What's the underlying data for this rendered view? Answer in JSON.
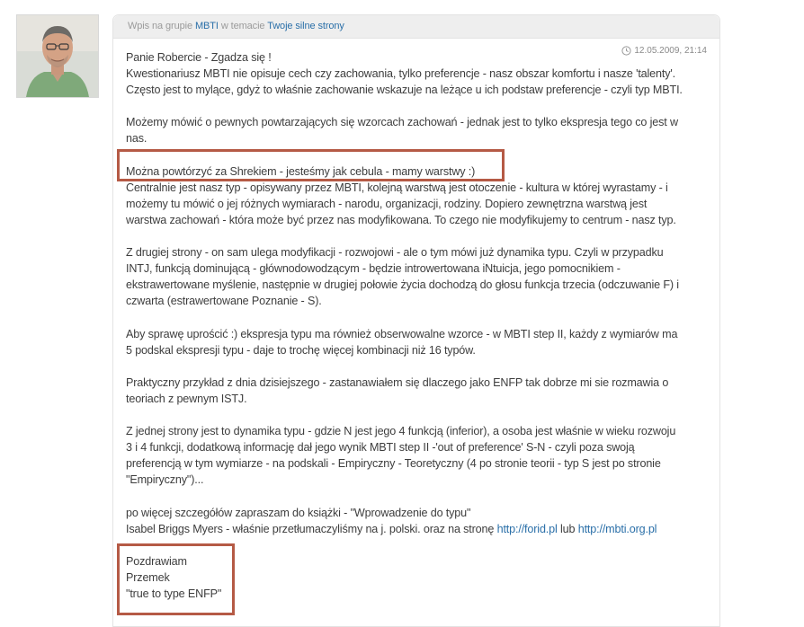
{
  "header": {
    "prefix": "Wpis na grupie",
    "group_link": "MBTI",
    "middle": "w temacie",
    "topic_link": "Twoje silne strony"
  },
  "post": {
    "date": "12.05.2009, 21:14",
    "date_icon": "clock-icon",
    "avatar_icon": "user-avatar",
    "para1": [
      "Panie Robercie - Zgadza się !",
      "Kwestionariusz MBTI nie opisuje cech czy zachowania, tylko preferencje - nasz obszar komfortu i nasze 'talenty'.",
      "Często jest to mylące, gdyż to właśnie zachowanie wskazuje na leżące u ich podstaw preferencje - czyli typ MBTI."
    ],
    "para2": [
      "Możemy mówić o pewnych powtarzających się wzorcach zachowań - jednak jest to tylko ekspresja tego co jest w",
      "nas."
    ],
    "para3": [
      "Można powtórzyć za Shrekiem - jesteśmy jak cebula - mamy warstwy :)",
      "Centralnie jest nasz typ - opisywany przez MBTI, kolejną warstwą jest otoczenie - kultura w której wyrastamy - i",
      "możemy tu mówić o jej różnych wymiarach - narodu, organizacji, rodziny. Dopiero zewnętrzna warstwą jest",
      "warstwa zachowań - która może być przez nas modyfikowana. To czego nie modyfikujemy to centrum - nasz typ."
    ],
    "para4": [
      "Z drugiej strony - on sam ulega modyfikacji - rozwojowi - ale o tym mówi już dynamika typu. Czyli w przypadku",
      "INTJ, funkcją dominującą - głównodowodzącym - będzie introwertowana iNtuicja, jego pomocnikiem -",
      "ekstrawertowane myślenie, następnie w drugiej połowie życia dochodzą do głosu funkcja trzecia (odczuwanie F) i",
      "czwarta (estrawertowane Poznanie - S)."
    ],
    "para5": [
      "Aby sprawę uprościć :) ekspresja typu ma również obserwowalne wzorce - w MBTI step II, każdy z wymiarów ma",
      "5 podskal ekspresji typu - daje to trochę więcej kombinacji niż 16 typów."
    ],
    "para6": [
      "Praktyczny przykład z dnia dzisiejszego - zastanawiałem się dlaczego jako ENFP tak dobrze mi sie rozmawia o",
      "teoriach z pewnym ISTJ."
    ],
    "para7": [
      "Z jednej strony jest to dynamika typu - gdzie N jest jego 4 funkcją (inferior), a osoba jest właśnie w wieku rozwoju",
      "3 i 4 funkcji, dodatkową informację dał jego wynik MBTI step II -'out of preference' S-N - czyli poza swoją",
      "preferencją w tym wymiarze - na podskali - Empiryczny - Teoretyczny (4 po stronie teorii - typ S jest po stronie",
      "\"Empiryczny\")..."
    ],
    "para8": {
      "line1": "po więcej szczegółów zapraszam do książki - \"Wprowadzenie do typu\"",
      "line2_prefix": "Isabel Briggs Myers - właśnie przetłumaczyliśmy na j. polski. oraz na stronę ",
      "link1": "http://forid.pl",
      "between": " lub ",
      "link2": "http://mbti.org.pl"
    },
    "signature": [
      "Pozdrawiam",
      "Przemek",
      "\"true to type ENFP\""
    ]
  },
  "colors": {
    "link": "#2a6fa8",
    "highlight": "#b55a45",
    "header_bg": "#eeeeee"
  }
}
